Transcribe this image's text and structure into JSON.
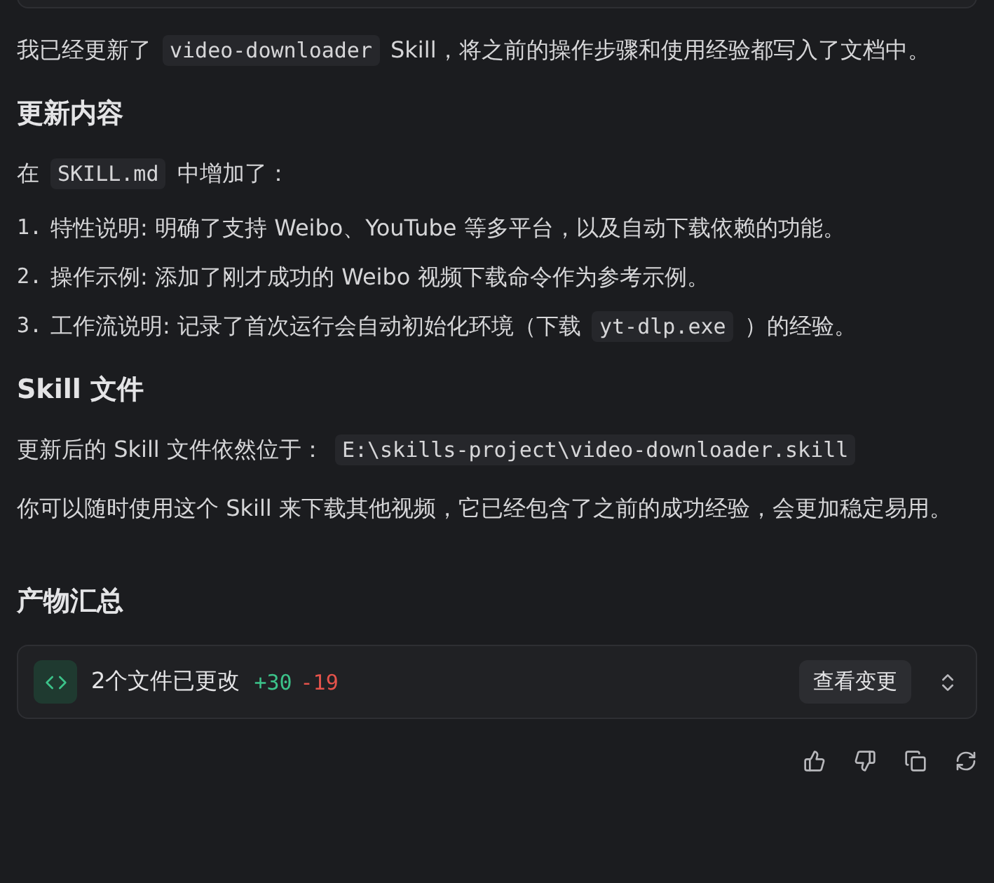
{
  "blocks": [
    {
      "kind": "paragraph",
      "segments": [
        {
          "kind": "text",
          "text": "我已经更新了"
        },
        {
          "kind": "code",
          "text": "video-downloader"
        },
        {
          "kind": "text",
          "text": "Skill，将之前的操作步骤和使用经验都写入了文档中。"
        }
      ]
    },
    {
      "kind": "heading",
      "text": "更新内容"
    },
    {
      "kind": "paragraph",
      "segments": [
        {
          "kind": "text",
          "text": "在"
        },
        {
          "kind": "code",
          "text": "SKILL.md"
        },
        {
          "kind": "text",
          "text": "中增加了："
        }
      ]
    },
    {
      "kind": "list",
      "items": [
        {
          "number": "1.",
          "segments": [
            {
              "kind": "text",
              "text": "特性说明: 明确了支持 Weibo、YouTube 等多平台，以及自动下载依赖的功能。"
            }
          ]
        },
        {
          "number": "2.",
          "segments": [
            {
              "kind": "text",
              "text": "操作示例: 添加了刚才成功的 Weibo 视频下载命令作为参考示例。"
            }
          ]
        },
        {
          "number": "3.",
          "segments": [
            {
              "kind": "text",
              "text": "工作流说明: 记录了首次运行会自动初始化环境（下载"
            },
            {
              "kind": "code",
              "text": "yt-dlp.exe"
            },
            {
              "kind": "text",
              "text": "）的经验。"
            }
          ]
        }
      ]
    },
    {
      "kind": "heading",
      "text": "Skill 文件"
    },
    {
      "kind": "paragraph",
      "segments": [
        {
          "kind": "text",
          "text": "更新后的 Skill 文件依然位于："
        },
        {
          "kind": "code",
          "text": "E:\\skills-project\\video-downloader.skill"
        }
      ]
    },
    {
      "kind": "paragraph",
      "segments": [
        {
          "kind": "text",
          "text": "你可以随时使用这个 Skill 来下载其他视频，它已经包含了之前的成功经验，会更加稳定易用。"
        }
      ]
    },
    {
      "kind": "spacer"
    },
    {
      "kind": "heading",
      "text": "产物汇总"
    }
  ],
  "changes": {
    "summary": "2个文件已更改",
    "added": "+30",
    "removed": "-19",
    "button": "查看变更"
  }
}
